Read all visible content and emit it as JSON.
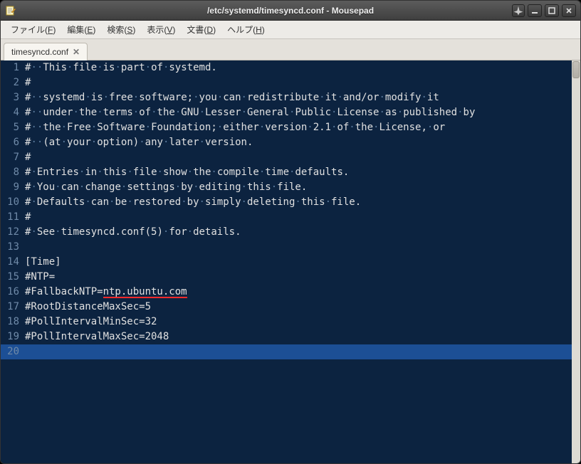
{
  "titlebar": {
    "title": "/etc/systemd/timesyncd.conf - Mousepad",
    "appIconName": "mousepad-icon"
  },
  "menubar": [
    {
      "label": "ファイル",
      "accel": "F"
    },
    {
      "label": "編集",
      "accel": "E"
    },
    {
      "label": "検索",
      "accel": "S"
    },
    {
      "label": "表示",
      "accel": "V"
    },
    {
      "label": "文書",
      "accel": "D"
    },
    {
      "label": "ヘルプ",
      "accel": "H"
    }
  ],
  "tabs": [
    {
      "label": "timesyncd.conf",
      "modified": true
    }
  ],
  "editor": {
    "currentLine": 20,
    "spellErrorLine": 16,
    "spellErrorText": "ntp.ubuntu.com",
    "lines": [
      "#  This file is part of systemd.",
      "#",
      "#  systemd is free software; you can redistribute it and/or modify it",
      "#  under the terms of the GNU Lesser General Public License as published by",
      "#  the Free Software Foundation; either version 2.1 of the License, or",
      "#  (at your option) any later version.",
      "#",
      "# Entries in this file show the compile time defaults.",
      "# You can change settings by editing this file.",
      "# Defaults can be restored by simply deleting this file.",
      "#",
      "# See timesyncd.conf(5) for details.",
      "",
      "[Time]",
      "#NTP=",
      "#FallbackNTP=ntp.ubuntu.com",
      "#RootDistanceMaxSec=5",
      "#PollIntervalMinSec=32",
      "#PollIntervalMaxSec=2048",
      ""
    ]
  },
  "colors": {
    "editorBg": "#0c2340",
    "currentLineBg": "#1c4f95",
    "gutterFg": "#6f8aa8",
    "whitespaceFg": "#5a7a9c",
    "textFg": "#e0e0e0"
  }
}
